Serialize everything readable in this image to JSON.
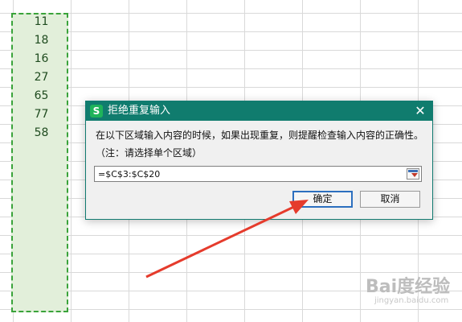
{
  "cells": [
    "11",
    "18",
    "16",
    "27",
    "65",
    "77",
    "58"
  ],
  "dialog": {
    "title": "拒绝重复输入",
    "app_icon_letter": "S",
    "close_symbol": "✕",
    "message": "在以下区域输入内容的时候，如果出现重复，则提醒检查输入内容的正确性。",
    "note": "（注：请选择单个区域）",
    "range_value": "=$C$3:$C$20",
    "ok_label": "确定",
    "cancel_label": "取消"
  },
  "watermark": {
    "text": "Bai度经验",
    "sub": "jingyan.baidu.com"
  },
  "colors": {
    "titlebar": "#107c6e",
    "selection_fill": "#e2efda",
    "selection_border": "#3aa33a",
    "annotation_arrow": "#e53b2c"
  }
}
